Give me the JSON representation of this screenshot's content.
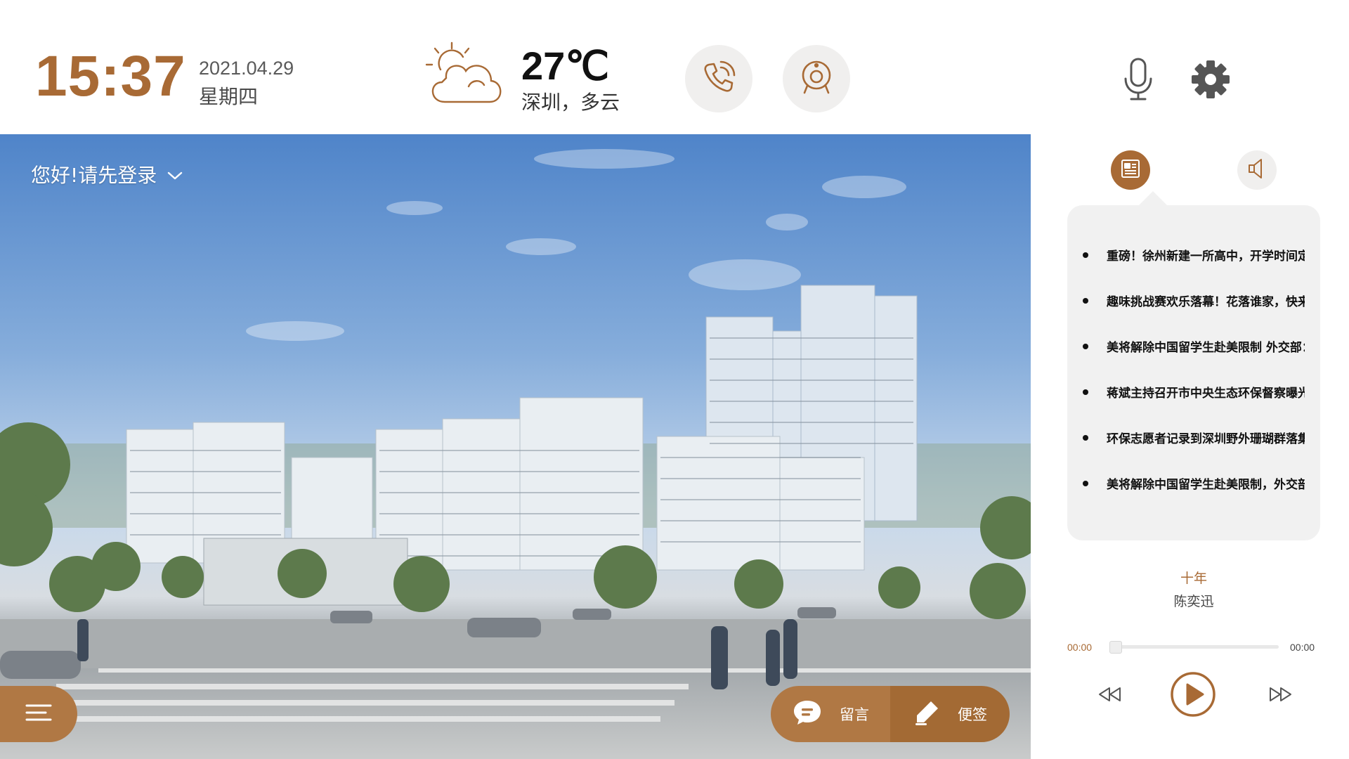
{
  "header": {
    "time": "15:37",
    "date": "2021.04.29",
    "weekday": "星期四",
    "weather": {
      "icon": "partly-cloudy-icon",
      "temperature": "27℃",
      "location": "深圳，多云"
    },
    "buttons": [
      {
        "name": "phone",
        "icon": "phone-call-icon"
      },
      {
        "name": "camera",
        "icon": "camera-icon"
      },
      {
        "name": "microphone",
        "icon": "microphone-icon"
      },
      {
        "name": "settings",
        "icon": "gear-icon"
      }
    ]
  },
  "main": {
    "greeting": "您好!请先登录",
    "background_image": "residential-buildings-rendering",
    "actions": {
      "menu_icon": "menu-lines-icon",
      "message_label": "留言",
      "message_icon": "chat-bubble-icon",
      "note_label": "便签",
      "note_icon": "pen-icon"
    }
  },
  "sidebar": {
    "tabs": [
      {
        "name": "news",
        "icon": "newspaper-icon",
        "active": true
      },
      {
        "name": "audio",
        "icon": "speaker-icon",
        "active": false
      }
    ],
    "news": [
      "重磅！徐州新建一所高中，开学时间定",
      "趣味挑战赛欢乐落幕！花落谁家，快来",
      "美将解除中国留学生赴美限制 外交部：",
      "蒋斌主持召开市中央生态环保督察曝光",
      "环保志愿者记录到深圳野外珊瑚群落集",
      "美将解除中国留学生赴美限制，外交部"
    ],
    "player": {
      "title": "十年",
      "artist": "陈奕迅",
      "current_time": "00:00",
      "total_time": "00:00",
      "progress": 0
    }
  },
  "colors": {
    "accent": "#a86a35",
    "accent_light": "#b07844",
    "panel_bg": "#f1f1f1",
    "button_bg": "#f0efee"
  }
}
